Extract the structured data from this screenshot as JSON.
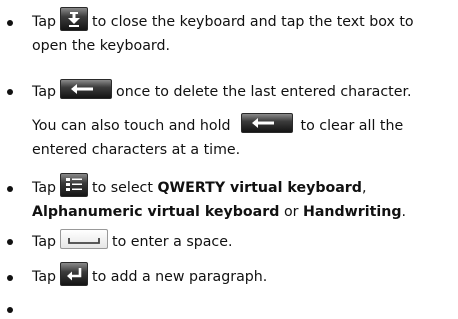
{
  "items": [
    {
      "before": "Tap",
      "icon": "keyboard-down-arrow-icon",
      "after": "to close the keyboard and tap the text box to",
      "line2": "open the keyboard."
    },
    {
      "before": "Tap",
      "icon": "backspace-arrow-icon",
      "after": "once to delete the last entered character.",
      "sub_before": "You can also touch and hold",
      "sub_icon": "backspace-arrow-icon",
      "sub_after": "to clear all the",
      "sub_line2": "entered characters at a time."
    },
    {
      "before": "Tap",
      "icon": "keyboard-layout-icon",
      "after": "to select",
      "bold1": "QWERTY virtual keyboard",
      "sep1": ",",
      "bold2": "Alphanumeric virtual keyboard",
      "sep2": "or",
      "bold3": "Handwriting",
      "end": "."
    },
    {
      "before": "Tap",
      "icon": "space-bar-icon",
      "after": "to enter a space."
    },
    {
      "before": "Tap",
      "icon": "enter-return-icon",
      "after": "to add a new paragraph."
    },
    {}
  ]
}
